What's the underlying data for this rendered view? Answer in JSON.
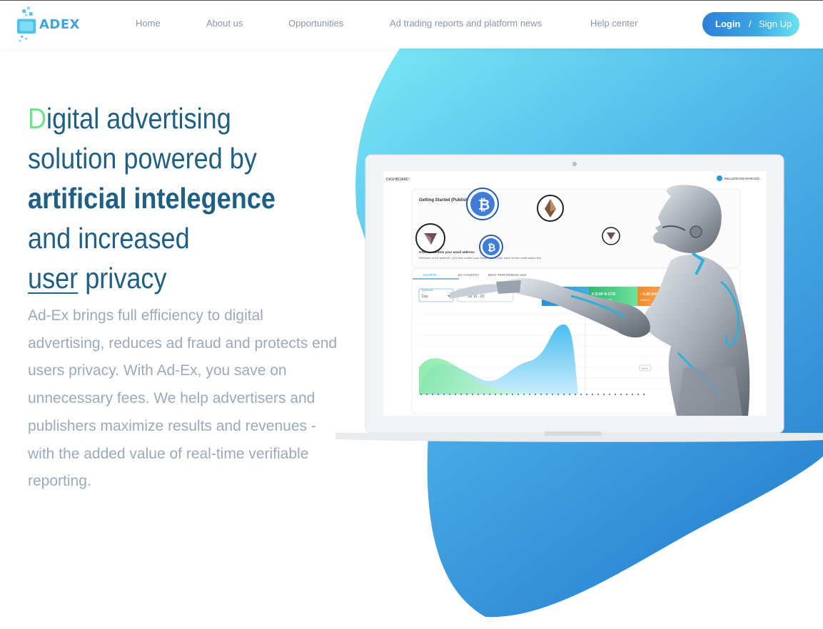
{
  "brand": {
    "name": "ADEX",
    "colors": {
      "accent": "#3fa5d8",
      "heading": "#1f5f83",
      "highlight": "#6ee28f",
      "body_text": "#9aaabb",
      "nav_text": "#8a97a8"
    }
  },
  "nav": {
    "items": [
      {
        "label": "Home"
      },
      {
        "label": "About us"
      },
      {
        "label": "Opportunities"
      },
      {
        "label": "Ad trading reports and platform news"
      },
      {
        "label": "Help center"
      }
    ]
  },
  "auth": {
    "login": "Login",
    "separator": "/",
    "signup": "Sign Up"
  },
  "hero": {
    "title": {
      "first_letter": "D",
      "line1_rest": "igital advertising",
      "line2": "solution powered by",
      "line3_bold": "artificial intelegence",
      "line4": "and increased",
      "line5_underlined": "user",
      "line5_rest": " privacy"
    },
    "description": "Ad-Ex brings full efficiency to digital advertising, reduces ad fraud and protects end users privacy. With Ad-Ex, you save on unnecessary fees. We help advertisers and publishers maximize results and revenues - with the added value of real-time verifiable reporting."
  },
  "dashboard": {
    "header_label": "DASHBOARD",
    "user_label": "DELLENCGRAPHICS@...",
    "card_title": "Getting Started (Publisher)",
    "step_text": "STEP 1: Confirm your email address",
    "welcome_text": "Welcome to the platform. Let's first confirm your email. Check your inbox for the confirmation link.",
    "tabs": [
      "CHARTS",
      "BY COUNTRY",
      "BEST PERFORMING ADS"
    ],
    "timeframe_label": "Timeframe",
    "timeframe_value": "Day",
    "date_value": "Jul 10 - 20",
    "stat_ctr_value": "0 (0.00 % CTR",
    "stat_ctr_label": "Total clicks & CTR",
    "stat_rev_value": "~ 0.00 DAI",
    "stat_rev_label": "Total rev...",
    "now_label": "NOW"
  }
}
